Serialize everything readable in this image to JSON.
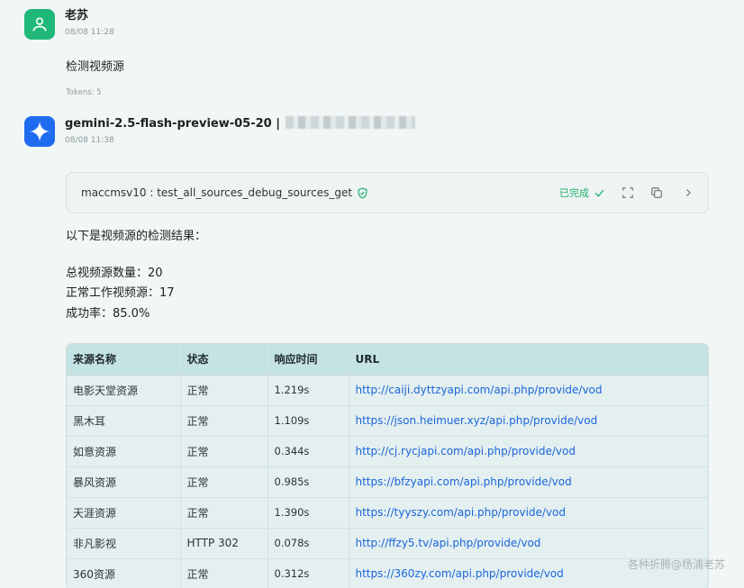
{
  "user_message": {
    "sender": "老苏",
    "time": "08/08 11:28",
    "text": "检测视频源",
    "tokens": "Tokens: 5"
  },
  "assistant_message": {
    "sender": "gemini-2.5-flash-preview-05-20 |",
    "time": "08/08 11:38",
    "tool_call": {
      "name": "maccmsv10 : test_all_sources_debug_sources_get",
      "status": "已完成"
    },
    "intro": "以下是视频源的检测结果：",
    "summary": [
      "总视频源数量：20",
      "正常工作视频源：17",
      "成功率：85.0%"
    ],
    "table": {
      "headers": [
        "来源名称",
        "状态",
        "响应时间",
        "URL"
      ],
      "rows": [
        [
          "电影天堂资源",
          "正常",
          "1.219s",
          "http://caiji.dyttzyapi.com/api.php/provide/vod"
        ],
        [
          "黑木耳",
          "正常",
          "1.109s",
          "https://json.heimuer.xyz/api.php/provide/vod"
        ],
        [
          "如意资源",
          "正常",
          "0.344s",
          "http://cj.rycjapi.com/api.php/provide/vod"
        ],
        [
          "暴风资源",
          "正常",
          "0.985s",
          "https://bfzyapi.com/api.php/provide/vod"
        ],
        [
          "天涯资源",
          "正常",
          "1.390s",
          "https://tyyszy.com/api.php/provide/vod"
        ],
        [
          "非凡影视",
          "HTTP 302",
          "0.078s",
          "http://ffzy5.tv/api.php/provide/vod"
        ],
        [
          "360资源",
          "正常",
          "0.312s",
          "https://360zy.com/api.php/provide/vod"
        ]
      ]
    }
  },
  "watermark": "各种折腾@杨浦老苏",
  "colors": {
    "user_avatar": "#1fb879",
    "bot_avatar": "#1f6cf0",
    "status_done": "#1fb06a",
    "link": "#1a66d8",
    "table_header": "#c6e3e3"
  },
  "icons": {
    "user_avatar": "user-icon",
    "bot_avatar": "gemini-sparkle-icon",
    "tool_verified": "shield-check-icon",
    "tool_done": "check-icon",
    "tool_expand": "fullscreen-icon",
    "tool_copy": "copy-icon",
    "tool_open": "chevron-right-icon"
  }
}
